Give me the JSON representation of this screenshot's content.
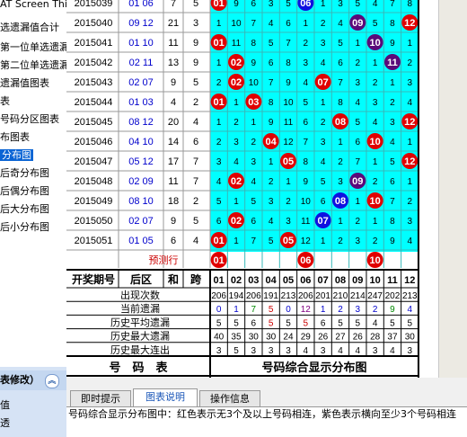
{
  "sidebar": {
    "items": [
      {
        "label": "AT Screen Thief"
      },
      {
        "label": "选遗漏值合计"
      },
      {
        "label": "第一位单选遗漏"
      },
      {
        "label": "第二位单选遗漏"
      },
      {
        "label": "遗漏值图表"
      },
      {
        "label": "表"
      },
      {
        "label": "号码分区图表"
      },
      {
        "label": "布图表"
      },
      {
        "label": "分布图",
        "selected": true
      },
      {
        "label": "后奇分布图"
      },
      {
        "label": "后偶分布图"
      },
      {
        "label": "后大分布图"
      },
      {
        "label": "后小分布图"
      }
    ],
    "panel_title": "表修改）",
    "panel_items": [
      "值",
      "透"
    ]
  },
  "numbers": [
    "01",
    "02",
    "03",
    "04",
    "05",
    "06",
    "07",
    "08",
    "09",
    "10",
    "11",
    "12"
  ],
  "rows": [
    {
      "period": "2015039",
      "back": "01 06",
      "sum": "7",
      "span": "5",
      "cells": [
        "01",
        "9",
        "6",
        "3",
        "5",
        "06",
        "1",
        "3",
        "5",
        "4",
        "7",
        "8"
      ]
    },
    {
      "period": "2015040",
      "back": "09 12",
      "sum": "21",
      "span": "3",
      "cells": [
        "1",
        "10",
        "7",
        "4",
        "6",
        "1",
        "2",
        "4",
        "09",
        "5",
        "8",
        "12"
      ]
    },
    {
      "period": "2015041",
      "back": "01 10",
      "sum": "11",
      "span": "9",
      "cells": [
        "01",
        "11",
        "8",
        "5",
        "7",
        "2",
        "3",
        "5",
        "1",
        "10",
        "9",
        "1"
      ]
    },
    {
      "period": "2015042",
      "back": "02 11",
      "sum": "13",
      "span": "9",
      "cells": [
        "1",
        "02",
        "9",
        "6",
        "8",
        "3",
        "4",
        "6",
        "2",
        "1",
        "11",
        "2"
      ]
    },
    {
      "period": "2015043",
      "back": "02 07",
      "sum": "9",
      "span": "5",
      "cells": [
        "2",
        "02",
        "10",
        "7",
        "9",
        "4",
        "07",
        "7",
        "3",
        "2",
        "1",
        "3"
      ]
    },
    {
      "period": "2015044",
      "back": "01 03",
      "sum": "4",
      "span": "2",
      "cells": [
        "01",
        "1",
        "03",
        "8",
        "10",
        "5",
        "1",
        "8",
        "4",
        "3",
        "2",
        "4"
      ]
    },
    {
      "period": "2015045",
      "back": "08 12",
      "sum": "20",
      "span": "4",
      "cells": [
        "1",
        "2",
        "1",
        "9",
        "11",
        "6",
        "2",
        "08",
        "5",
        "4",
        "3",
        "12"
      ]
    },
    {
      "period": "2015046",
      "back": "04 10",
      "sum": "14",
      "span": "6",
      "cells": [
        "2",
        "3",
        "2",
        "04",
        "12",
        "7",
        "3",
        "1",
        "6",
        "10",
        "4",
        "1"
      ]
    },
    {
      "period": "2015047",
      "back": "05 12",
      "sum": "17",
      "span": "7",
      "cells": [
        "3",
        "4",
        "3",
        "1",
        "05",
        "8",
        "4",
        "2",
        "7",
        "1",
        "5",
        "12"
      ]
    },
    {
      "period": "2015048",
      "back": "02 09",
      "sum": "11",
      "span": "7",
      "cells": [
        "4",
        "02",
        "4",
        "2",
        "1",
        "9",
        "5",
        "3",
        "09",
        "2",
        "6",
        "1"
      ]
    },
    {
      "period": "2015049",
      "back": "08 10",
      "sum": "18",
      "span": "2",
      "cells": [
        "5",
        "1",
        "5",
        "3",
        "2",
        "10",
        "6",
        "08",
        "1",
        "10",
        "7",
        "2"
      ]
    },
    {
      "period": "2015050",
      "back": "02 07",
      "sum": "9",
      "span": "5",
      "cells": [
        "6",
        "02",
        "6",
        "4",
        "3",
        "11",
        "07",
        "1",
        "2",
        "1",
        "8",
        "3"
      ]
    },
    {
      "period": "2015051",
      "back": "01 05",
      "sum": "6",
      "span": "4",
      "cells": [
        "01",
        "1",
        "7",
        "5",
        "05",
        "12",
        "1",
        "2",
        "3",
        "2",
        "9",
        "4"
      ]
    }
  ],
  "predict": {
    "label": "预测行",
    "balls": [
      "01",
      "06",
      "10"
    ]
  },
  "header": {
    "period": "开奖期号",
    "back": "后区",
    "sum": "和",
    "span": "跨"
  },
  "stats": [
    {
      "label": "出现次数",
      "values": [
        "206",
        "194",
        "206",
        "191",
        "213",
        "206",
        "201",
        "210",
        "214",
        "247",
        "202",
        "213"
      ]
    },
    {
      "label": "当前遗漏",
      "values": [
        "0",
        "1",
        "7",
        "5",
        "0",
        "12",
        "1",
        "2",
        "3",
        "2",
        "9",
        "4"
      ]
    },
    {
      "label": "历史平均遗漏",
      "values": [
        "5",
        "5",
        "6",
        "5",
        "5",
        "5",
        "6",
        "5",
        "5",
        "4",
        "5",
        "5"
      ]
    },
    {
      "label": "历史最大遗漏",
      "values": [
        "40",
        "35",
        "30",
        "30",
        "24",
        "29",
        "26",
        "27",
        "26",
        "28",
        "37",
        "30"
      ]
    },
    {
      "label": "历史最大连出",
      "values": [
        "3",
        "5",
        "3",
        "3",
        "3",
        "4",
        "3",
        "4",
        "4",
        "3",
        "4",
        "3"
      ]
    }
  ],
  "footer": {
    "left": "号　码　表",
    "right": "号码综合显示分布图"
  },
  "tabs": [
    "即时提示",
    "图表说明",
    "操作信息"
  ],
  "active_tab": 1,
  "description": "号码综合显示分布图中：红色表示无3个及以上号码相连，紫色表示横向至少3个号码相连",
  "colors": {
    "cyan": "#00ffff",
    "red": "#e00000",
    "blue": "#1010e0",
    "purple": "#5a0a7a",
    "stat_blue": "#0000cc",
    "stat_green": "#008800",
    "stat_purple": "#800080",
    "stat_red": "#cc0000"
  }
}
